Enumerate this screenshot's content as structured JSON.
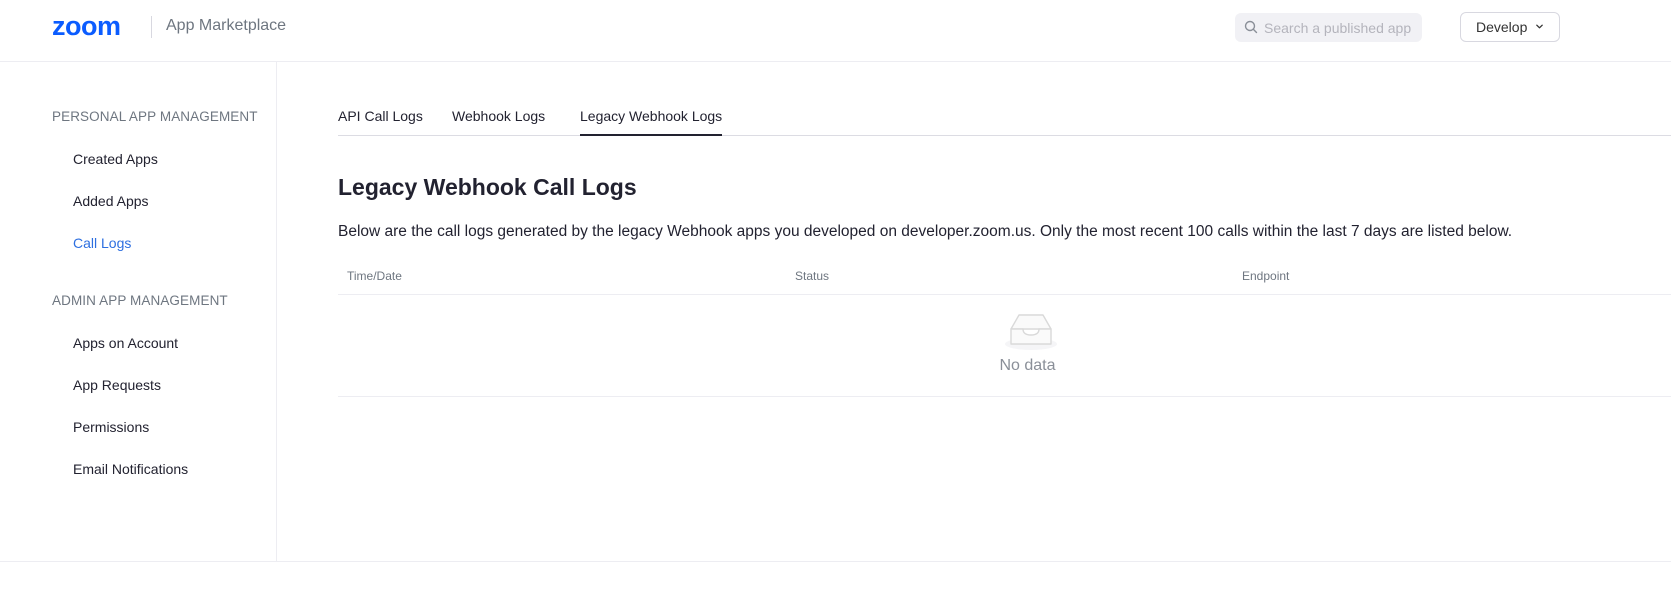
{
  "header": {
    "logo_text": "zoom",
    "app_title": "App Marketplace",
    "search": {
      "placeholder": "Search a published app",
      "value": ""
    },
    "develop_label": "Develop"
  },
  "sidebar": {
    "personal_title": "PERSONAL APP MANAGEMENT",
    "personal_items": [
      {
        "label": "Created Apps"
      },
      {
        "label": "Added Apps"
      },
      {
        "label": "Call Logs",
        "active": true
      }
    ],
    "admin_title": "ADMIN APP MANAGEMENT",
    "admin_items": [
      {
        "label": "Apps on Account"
      },
      {
        "label": "App Requests"
      },
      {
        "label": "Permissions"
      },
      {
        "label": "Email Notifications"
      }
    ]
  },
  "tabs": [
    {
      "label": "API Call Logs"
    },
    {
      "label": "Webhook Logs"
    },
    {
      "label": "Legacy Webhook Logs",
      "active": true
    }
  ],
  "main": {
    "title": "Legacy Webhook Call Logs",
    "description": "Below are the call logs generated by the legacy Webhook apps you developed on developer.zoom.us. Only the most recent 100 calls within the last 7 days are listed below.",
    "columns": [
      "Time/Date",
      "Status",
      "Endpoint"
    ],
    "empty_text": "No data"
  },
  "colors": {
    "brand": "#0b5cff",
    "active_link": "#2d6fe0",
    "text": "#222230",
    "muted": "#6e7680"
  },
  "icons": {
    "logo": "zoom-logo",
    "search": "search-icon",
    "chevron": "chevron-down-icon",
    "empty": "inbox-icon"
  }
}
